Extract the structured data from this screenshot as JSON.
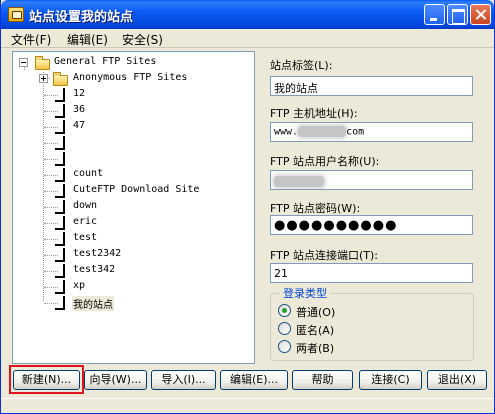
{
  "window": {
    "title": "站点设置我的站点"
  },
  "menu": [
    "文件(F)",
    "编辑(E)",
    "安全(S)"
  ],
  "tree": {
    "root": "General FTP Sites",
    "anonymous": "Anonymous FTP Sites",
    "sites": [
      "12",
      "36",
      "47",
      "",
      "",
      "count",
      "CuteFTP Download Site",
      "down",
      "eric",
      "test",
      "test2342",
      "test342",
      "xp",
      "我的站点"
    ],
    "selected": "我的站点"
  },
  "form": {
    "label_label": "站点标签(L):",
    "label_value": "我的站点",
    "host_label": "FTP 主机地址(H):",
    "host_prefix": "www.",
    "host_suffix": "com",
    "user_label": "FTP 站点用户名称(U):",
    "password_label": "FTP 站点密码(W):",
    "password_value": "●●●●●●●●●●",
    "port_label": "FTP 站点连接端口(T):",
    "port_value": "21",
    "login_group": "登录类型",
    "login_options": [
      "普通(O)",
      "匿名(A)",
      "两者(B)"
    ],
    "login_selected": 0
  },
  "buttons": {
    "new": "新建(N)...",
    "wizard": "向导(W)...",
    "import": "导入(I)...",
    "edit": "编辑(E)...",
    "help": "帮助",
    "connect": "连接(C)",
    "exit": "退出(X)"
  },
  "colors": {
    "titlebar": "#0a5bf5",
    "highlight": "#e0141e",
    "radio_selected": "#21a121"
  }
}
